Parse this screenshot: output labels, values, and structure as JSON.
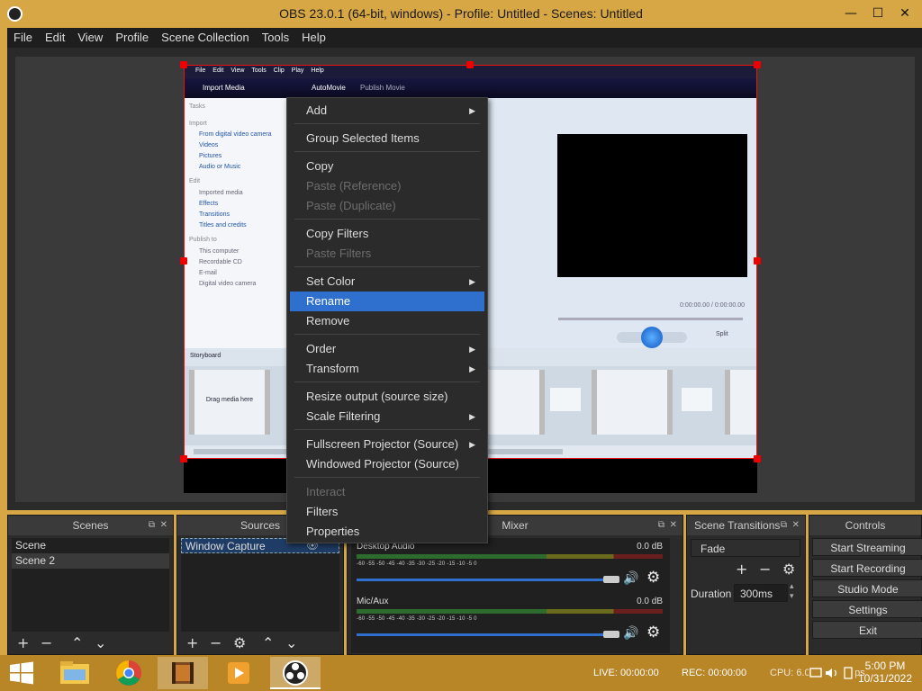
{
  "window": {
    "title": "OBS 23.0.1 (64-bit, windows) - Profile: Untitled - Scenes: Untitled",
    "minimize": "—",
    "maximize": "☐",
    "close": "✕"
  },
  "menubar": [
    "File",
    "Edit",
    "View",
    "Profile",
    "Scene Collection",
    "Tools",
    "Help"
  ],
  "captured": {
    "menu": [
      "File",
      "Edit",
      "View",
      "Tools",
      "Clip",
      "Play",
      "Help"
    ],
    "toolbar": {
      "import": "Import Media",
      "automovie": "AutoMovie",
      "publish": "Publish Movie"
    },
    "tasks_title": "Tasks",
    "import_header": "Import",
    "import_items": [
      "From digital video camera",
      "Videos",
      "Pictures",
      "Audio or Music"
    ],
    "edit_header": "Edit",
    "edit_items": [
      "Imported media",
      "Effects",
      "Transitions",
      "Titles and credits"
    ],
    "publish_header": "Publish to",
    "publish_items": [
      "This computer",
      "Recordable CD",
      "E-mail",
      "Digital video camera"
    ],
    "timecode": "0:00:00.00 / 0:00:00.00",
    "split": "Split",
    "storyboard": "Storyboard",
    "drag_text": "Drag media here"
  },
  "context_menu": {
    "items": [
      {
        "label": "Add",
        "submenu": true,
        "disabled": false
      },
      {
        "label": "Group Selected Items",
        "disabled": false
      },
      {
        "label": "Copy",
        "disabled": false
      },
      {
        "label": "Paste (Reference)",
        "disabled": true
      },
      {
        "label": "Paste (Duplicate)",
        "disabled": true
      },
      {
        "label": "Copy Filters",
        "disabled": false
      },
      {
        "label": "Paste Filters",
        "disabled": true
      },
      {
        "label": "Set Color",
        "submenu": true,
        "disabled": false
      },
      {
        "label": "Rename",
        "selected": true,
        "disabled": false
      },
      {
        "label": "Remove",
        "disabled": false
      },
      {
        "label": "Order",
        "submenu": true,
        "disabled": false
      },
      {
        "label": "Transform",
        "submenu": true,
        "disabled": false
      },
      {
        "label": "Resize output (source size)",
        "disabled": false
      },
      {
        "label": "Scale Filtering",
        "submenu": true,
        "disabled": false
      },
      {
        "label": "Fullscreen Projector (Source)",
        "submenu": true,
        "disabled": false
      },
      {
        "label": "Windowed Projector (Source)",
        "disabled": false
      },
      {
        "label": "Interact",
        "disabled": true
      },
      {
        "label": "Filters",
        "disabled": false
      },
      {
        "label": "Properties",
        "disabled": false
      }
    ],
    "arrow": "▶"
  },
  "docks": {
    "scenes": {
      "title": "Scenes",
      "items": [
        "Scene",
        "Scene 2"
      ]
    },
    "sources": {
      "title": "Sources",
      "items": [
        "Window Capture"
      ]
    },
    "mixer": {
      "title": "Mixer",
      "tracks": [
        {
          "name": "Desktop Audio",
          "db": "0.0 dB"
        },
        {
          "name": "Mic/Aux",
          "db": "0.0 dB"
        }
      ],
      "ticks": "-60   -55   -50   -45   -40   -35   -30   -25   -20   -15   -10   -5    0"
    },
    "transitions": {
      "title": "Scene Transitions",
      "selected": "Fade",
      "duration_label": "Duration",
      "duration": "300ms"
    },
    "controls": {
      "title": "Controls",
      "buttons": [
        "Start Streaming",
        "Start Recording",
        "Studio Mode",
        "Settings",
        "Exit"
      ]
    }
  },
  "glyphs": {
    "add": "+",
    "remove": "−",
    "up": "⌃",
    "down": "⌄",
    "gear": "⚙",
    "speaker": "🔊",
    "eye": "👁",
    "float": "⧉",
    "close": "✕",
    "spin_up": "▴",
    "spin_down": "▾"
  },
  "status": {
    "live": "LIVE: 00:00:00",
    "rec": "REC: 00:00:00",
    "cpu": "CPU: 6.0%, 30.00 fps"
  },
  "clock": {
    "time": "5:00 PM",
    "date": "10/31/2022"
  },
  "colors": {
    "titlebar": "#d7a745",
    "selection": "#2f6fce",
    "source_outline": "#ee1111"
  }
}
